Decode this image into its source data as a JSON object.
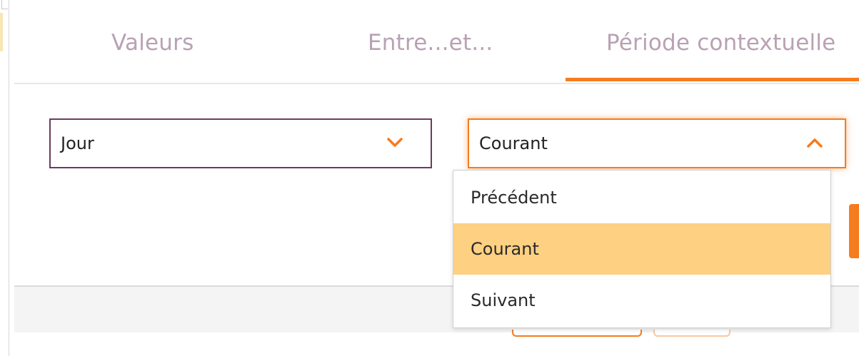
{
  "tabs": [
    {
      "label": "Valeurs",
      "active": false
    },
    {
      "label": "Entre...et...",
      "active": false
    },
    {
      "label": "Période contextuelle",
      "active": true
    }
  ],
  "colors": {
    "accent": "#f57c1f",
    "tab_text": "#b9a1b3",
    "select_border": "#6c3b5e",
    "highlight": "#fed082"
  },
  "unit_select": {
    "value": "Jour",
    "icon": "chevron-down-icon"
  },
  "period_select": {
    "value": "Courant",
    "icon": "chevron-up-icon",
    "options": [
      "Précédent",
      "Courant",
      "Suivant"
    ],
    "selected_index": 1
  }
}
